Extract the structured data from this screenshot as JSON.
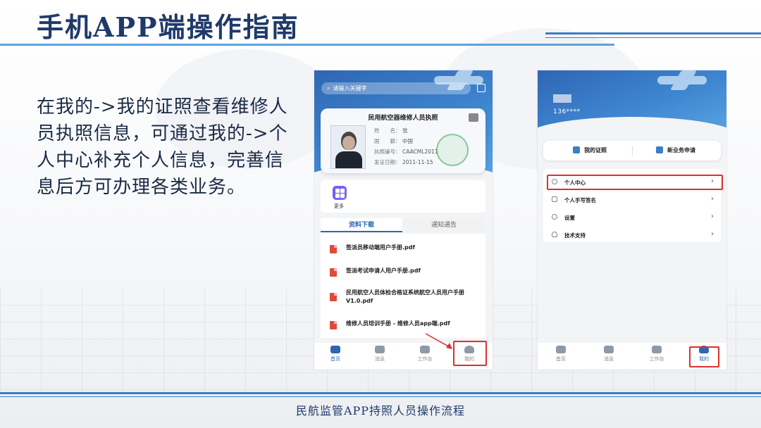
{
  "slide": {
    "title": "手机APP端操作指南",
    "description": "在我的->我的证照查看维修人员执照信息，可通过我的->个人中心补充个人信息，完善信息后方可办理各类业务。",
    "footer": "民航监管APP持照人员操作流程"
  },
  "phone_home": {
    "search_placeholder": "请输入关键字",
    "license_card": {
      "title": "民用航空器维修人员执照",
      "fields": [
        {
          "label": "姓　　名：",
          "value": "张"
        },
        {
          "label": "国　　籍：",
          "value": "中国"
        },
        {
          "label": "执照编号：",
          "value": "CAACML2011"
        },
        {
          "label": "发证日期：",
          "value": "2011-11-15"
        }
      ]
    },
    "more_label": "更多",
    "tabs": [
      "资料下载",
      "通知通告"
    ],
    "documents": [
      "签派员移动端用户手册.pdf",
      "签派考试申请人用户手册.pdf",
      "民用航空人员体检合格证系统航空人员用户手册V1.0.pdf",
      "维修人员培训手册 - 维修人员app端.pdf"
    ],
    "nav": [
      "首页",
      "消息",
      "工作台",
      "我的"
    ]
  },
  "phone_profile": {
    "phone_number": "136****",
    "quick_actions": [
      "我的证照",
      "新业务申请"
    ],
    "menu": [
      "个人中心",
      "个人手写签名",
      "设置",
      "技术支持"
    ],
    "nav": [
      "首页",
      "消息",
      "工作台",
      "我的"
    ]
  },
  "colors": {
    "brand_blue": "#2f66b4",
    "highlight_red": "#e02f2f",
    "title_navy": "#1f3a6a"
  }
}
